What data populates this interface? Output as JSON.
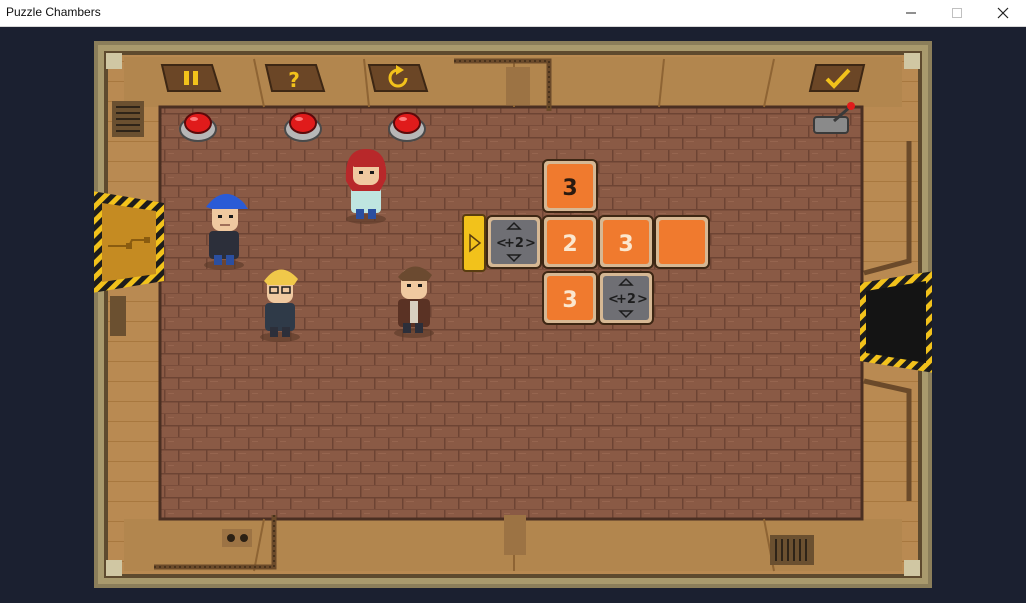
{
  "window": {
    "title": "Puzzle Chambers"
  },
  "hud": {
    "pause_icon": "pause-icon",
    "help_icon": "question-icon",
    "restart_icon": "restart-icon",
    "confirm_icon": "checkmark-icon"
  },
  "colors": {
    "floor": "#8a5a45",
    "wall": "#b98a52",
    "tile_orange": "#f07a2e",
    "tile_gray": "#6f6f74",
    "hazard_yellow": "#f2c21b",
    "button_red": "#e01b1b"
  },
  "puzzle": {
    "start_marker": "play-arrow-icon",
    "tiles": [
      {
        "id": "top",
        "type": "number",
        "value": "3"
      },
      {
        "id": "mid-gray",
        "type": "modifier",
        "value": "+2"
      },
      {
        "id": "mid-1",
        "type": "number",
        "value": "2"
      },
      {
        "id": "mid-2",
        "type": "number",
        "value": "3"
      },
      {
        "id": "mid-3",
        "type": "blank",
        "value": ""
      },
      {
        "id": "bot-1",
        "type": "number",
        "value": "3"
      },
      {
        "id": "bot-gray",
        "type": "modifier",
        "value": "+2"
      }
    ]
  },
  "characters": [
    {
      "name": "blue-cap-guy"
    },
    {
      "name": "red-haired-woman"
    },
    {
      "name": "blonde-glasses-guy"
    },
    {
      "name": "brown-jacket-guy"
    }
  ]
}
